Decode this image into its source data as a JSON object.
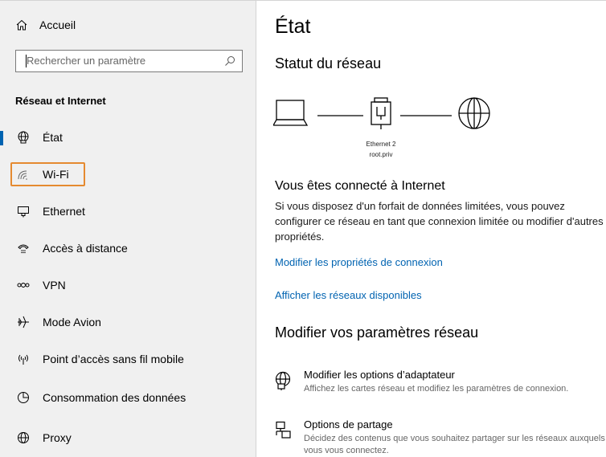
{
  "sidebar": {
    "home_label": "Accueil",
    "search_placeholder": "Rechercher un paramètre",
    "section_title": "Réseau et Internet",
    "items": [
      {
        "label": "État",
        "icon": "globe-status-icon"
      },
      {
        "label": "Wi-Fi",
        "icon": "wifi-icon"
      },
      {
        "label": "Ethernet",
        "icon": "ethernet-icon"
      },
      {
        "label": "Accès à distance",
        "icon": "dial-up-icon"
      },
      {
        "label": "VPN",
        "icon": "vpn-icon"
      },
      {
        "label": "Mode Avion",
        "icon": "airplane-icon"
      },
      {
        "label": "Point d’accès sans fil mobile",
        "icon": "hotspot-icon"
      },
      {
        "label": "Consommation des données",
        "icon": "data-usage-icon"
      },
      {
        "label": "Proxy",
        "icon": "globe-icon"
      }
    ],
    "active_index": 0,
    "highlight_color": "#e58a30"
  },
  "main": {
    "title": "État",
    "network_status_heading": "Statut du réseau",
    "adapter_name": "Ethernet 2",
    "network_name": "root.priv",
    "connected_heading": "Vous êtes connecté à Internet",
    "connected_desc": "Si vous disposez d'un forfait de données limitées, vous pouvez configurer ce réseau en tant que connexion limitée ou modifier d'autres propriétés.",
    "link_properties": "Modifier les propriétés de connexion",
    "link_networks": "Afficher les réseaux disponibles",
    "change_settings_heading": "Modifier vos paramètres réseau",
    "options": [
      {
        "title": "Modifier les options d’adaptateur",
        "desc": "Affichez les cartes réseau et modifiez les paramètres de connexion.",
        "icon": "adapter-icon"
      },
      {
        "title": "Options de partage",
        "desc": "Décidez des contenus que vous souhaitez partager sur les réseaux auxquels vous vous connectez.",
        "icon": "sharing-icon"
      }
    ],
    "accent_color": "#0063b1"
  }
}
